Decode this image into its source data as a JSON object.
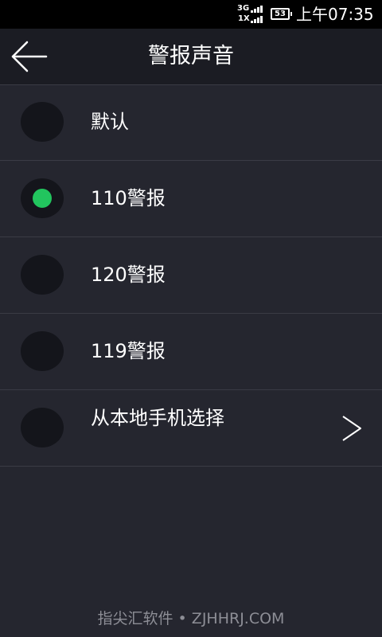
{
  "status_bar": {
    "network_top": "3G",
    "network_bottom": "1X",
    "battery": "53",
    "time": "上午07:35"
  },
  "header": {
    "title": "警报声音",
    "back_icon": "arrow-left-icon"
  },
  "items": [
    {
      "label": "默认",
      "selected": false
    },
    {
      "label": "110警报",
      "selected": true
    },
    {
      "label": "120警报",
      "selected": false
    },
    {
      "label": "119警报",
      "selected": false
    },
    {
      "label": "从本地手机选择",
      "selected": false,
      "icon": "chevron-right-icon"
    }
  ],
  "colors": {
    "background": "#25262f",
    "title_bar": "#1b1c23",
    "radio_fill": "#14151b",
    "accent": "#22c55e"
  },
  "watermark": "指尖汇软件 • ZJHHRJ.COM"
}
